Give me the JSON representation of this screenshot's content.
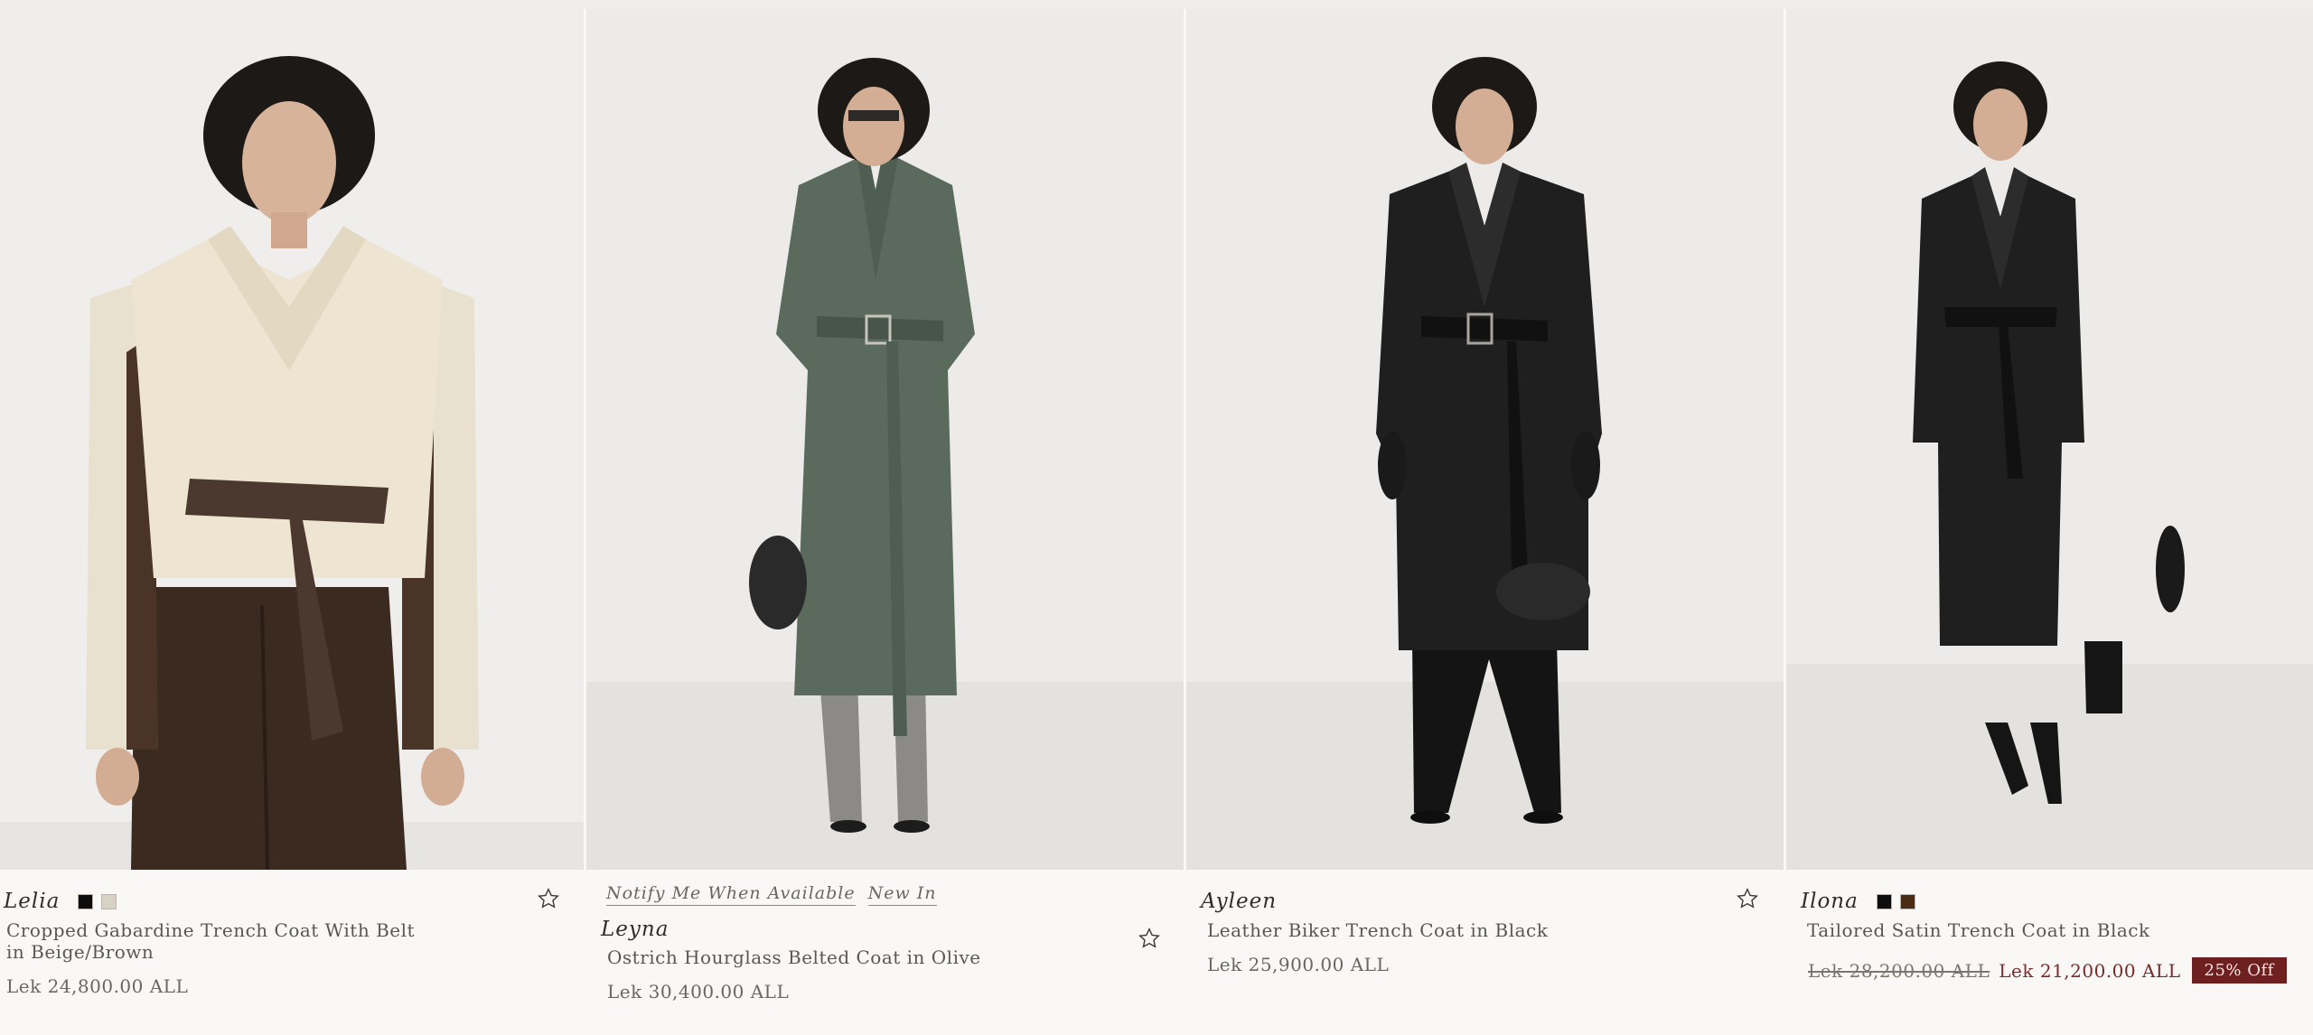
{
  "products": [
    {
      "brand": "Lelia",
      "name": "Cropped Gabardine Trench Coat With Belt in Beige/Brown",
      "price": "Lek 24,800.00 ALL",
      "swatches": [
        "#0d0d0d",
        "#d8d2c4"
      ],
      "favorite_icon": "star-outline-icon"
    },
    {
      "tags": [
        "Notify Me When Available",
        "New In"
      ],
      "brand": "Leyna",
      "name": "Ostrich Hourglass Belted Coat in Olive",
      "price": "Lek 30,400.00 ALL",
      "favorite_icon": "star-outline-icon"
    },
    {
      "brand": "Ayleen",
      "name": "Leather Biker Trench Coat in Black",
      "price": "Lek 25,900.00 ALL",
      "favorite_icon": "star-outline-icon"
    },
    {
      "brand": "Ilona",
      "name": "Tailored Satin Trench Coat in Black",
      "old_price": "Lek 28,200.00 ALL",
      "sale_price": "Lek 21,200.00 ALL",
      "discount_badge": "25% Off",
      "swatches": [
        "#0d0d0d",
        "#4a2c16"
      ]
    }
  ],
  "colors": {
    "background": "#f9f8f6",
    "photo_background": "#ededeb",
    "sale_text": "#7a2a2a",
    "badge_bg": "#6e1f1f"
  }
}
